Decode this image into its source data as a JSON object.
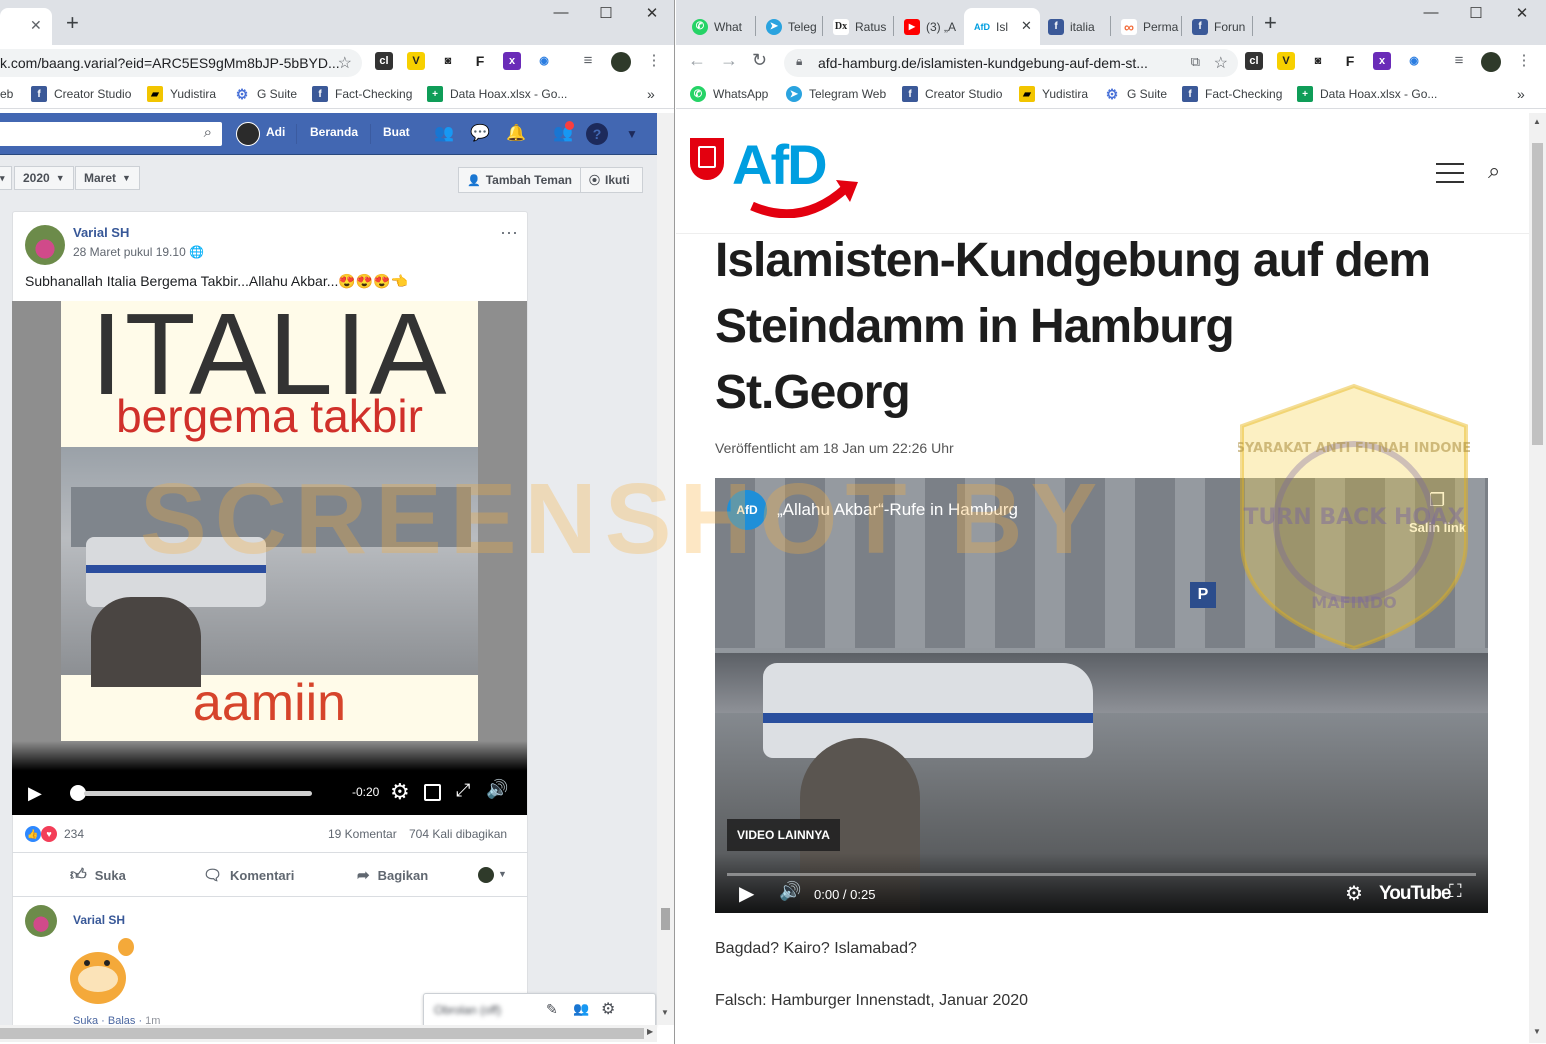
{
  "left_window": {
    "tabs": [
      {
        "label": ""
      }
    ],
    "url": "k.com/baang.varial?eid=ARC5ES9gMm8bJP-5bBYD...",
    "bookmarks": [
      {
        "label": "eb",
        "icon": "globe-icon"
      },
      {
        "label": "Creator Studio",
        "icon": "facebook-icon"
      },
      {
        "label": "Yudistira",
        "icon": "yudistira-icon"
      },
      {
        "label": "G Suite",
        "icon": "gear-icon"
      },
      {
        "label": "Fact-Checking",
        "icon": "facebook-icon"
      },
      {
        "label": "Data Hoax.xlsx - Go...",
        "icon": "sheets-icon"
      }
    ],
    "facebook": {
      "nav": {
        "user": "Adi",
        "home": "Beranda",
        "create": "Buat"
      },
      "year": "2020",
      "month": "Maret",
      "add_friend": "Tambah Teman",
      "follow": "Ikuti",
      "post": {
        "author": "Varial SH",
        "time": "28 Maret pukul 19.10",
        "text": "Subhanallah Italia Bergema Takbir...Allahu Akbar...😍😍😍👈",
        "video": {
          "overlay_title": "ITALIA",
          "overlay_subtitle": "bergema takbir",
          "overlay_footer": "aamiin",
          "time_left": "-0:20",
          "progress": 0.0
        },
        "reactions_count": "234",
        "comments": "19 Komentar",
        "shares": "704 Kali dibagikan",
        "actions": {
          "like": "Suka",
          "comment": "Komentari",
          "share": "Bagikan"
        },
        "comment": {
          "author": "Varial SH",
          "like": "Suka",
          "reply": "Balas",
          "age": "1m"
        }
      },
      "chat_label": "Obrolan (off)"
    }
  },
  "right_window": {
    "tabs": [
      {
        "label": "What",
        "icon": "whatsapp-icon",
        "color": "#25d366"
      },
      {
        "label": "Teleg",
        "icon": "telegram-icon",
        "color": "#2aa3df"
      },
      {
        "label": "Ratus",
        "icon": "dx-icon",
        "color": "#222222"
      },
      {
        "label": "(3) „A",
        "icon": "youtube-icon",
        "color": "#ff0000"
      },
      {
        "label": "Isl",
        "icon": "afd-icon",
        "color": "#009ee0"
      },
      {
        "label": "italia",
        "icon": "facebook-icon",
        "color": "#3b5998"
      },
      {
        "label": "Perma",
        "icon": "link-icon",
        "color": "#f26b3a"
      },
      {
        "label": "Forun",
        "icon": "facebook-icon",
        "color": "#3b5998"
      }
    ],
    "url": "afd-hamburg.de/islamisten-kundgebung-auf-dem-st...",
    "bookmarks": [
      {
        "label": "WhatsApp",
        "icon": "whatsapp-icon"
      },
      {
        "label": "Telegram Web",
        "icon": "telegram-icon"
      },
      {
        "label": "Creator Studio",
        "icon": "facebook-icon"
      },
      {
        "label": "Yudistira",
        "icon": "yudistira-icon"
      },
      {
        "label": "G Suite",
        "icon": "gear-icon"
      },
      {
        "label": "Fact-Checking",
        "icon": "facebook-icon"
      },
      {
        "label": "Data Hoax.xlsx - Go...",
        "icon": "sheets-icon"
      }
    ],
    "article": {
      "logo": "AfD",
      "title": "Islamisten-Kundgebung auf dem Steindamm in Hamburg St.Georg",
      "meta": "Veröffentlicht am 18 Jan um 22:26 Uhr",
      "video": {
        "title": "„Allahu Akbar“-Rufe in Hamburg",
        "channel_logo": "AfD",
        "copy_link": "Salin link",
        "more_videos": "VIDEO LAINNYA",
        "time": "0:00 / 0:25",
        "youtube_label": "YouTube",
        "progress": 0.0
      },
      "para1": "Bagdad? Kairo? Islamabad?",
      "para2": "Falsch: Hamburger Innenstadt, Januar 2020"
    }
  },
  "watermark": {
    "text": "SCREENSHOT BY",
    "seal_top": "MASYARAKAT ANTI FITNAH INDONESIA",
    "seal_mid": "TURN BACK HOAX",
    "seal_bottom": "MAFINDO"
  },
  "colors": {
    "facebook_blue": "#4267b2",
    "afd_blue": "#009ee0",
    "afd_red": "#e3000f",
    "watermark": "#f5a623"
  }
}
